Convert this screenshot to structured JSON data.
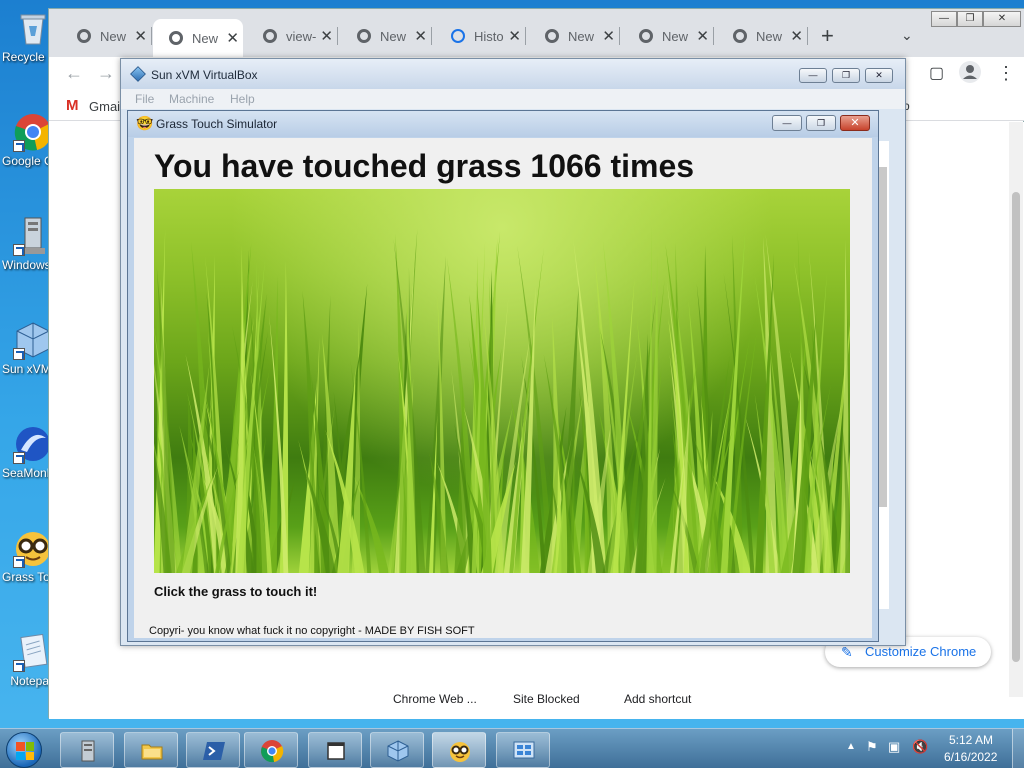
{
  "desktop": {
    "icons": [
      {
        "label": "Recycle Bin",
        "icon": "recycle-bin-icon"
      },
      {
        "label": "Google Chrome",
        "icon": "chrome-icon"
      },
      {
        "label": "Windows Console",
        "icon": "console-icon"
      },
      {
        "label": "Sun xVM VirtualBox",
        "icon": "virtualbox-icon"
      },
      {
        "label": "SeaMonkey",
        "icon": "seamonkey-icon"
      },
      {
        "label": "Grass Touch Simulator",
        "icon": "nerd-face-icon"
      },
      {
        "label": "Notepad",
        "icon": "notepad-icon"
      }
    ]
  },
  "chrome": {
    "tabs": [
      {
        "label": "New",
        "active": false,
        "icon": "chrome-globe-icon"
      },
      {
        "label": "New",
        "active": true,
        "icon": "chrome-globe-icon"
      },
      {
        "label": "view-",
        "active": false,
        "icon": "chrome-globe-icon"
      },
      {
        "label": "New",
        "active": false,
        "icon": "chrome-globe-icon"
      },
      {
        "label": "Histo",
        "active": false,
        "icon": "history-icon"
      },
      {
        "label": "New",
        "active": false,
        "icon": "chrome-globe-icon"
      },
      {
        "label": "New",
        "active": false,
        "icon": "chrome-globe-icon"
      },
      {
        "label": "New",
        "active": false,
        "icon": "chrome-globe-icon"
      }
    ],
    "bookmark": {
      "gmail_label": "Gmail",
      "right_fragment": "b"
    },
    "customize_label": "Customize Chrome",
    "shortcut_tiles": [
      "Chrome Web ...",
      "Site Blocked",
      "Add shortcut"
    ]
  },
  "vbox": {
    "title": "Sun xVM VirtualBox",
    "menu": [
      "File",
      "Machine",
      "Help"
    ]
  },
  "grass_app": {
    "title": "Grass Touch Simulator",
    "headline": "You have touched grass 1066 times",
    "touch_count": 1066,
    "cta": "Click the grass to touch it!",
    "copyright": "Copyri- you know what fuck it no copyright - MADE BY FISH SOFT"
  },
  "taskbar": {
    "items": [
      "server-manager-icon",
      "explorer-folder-icon",
      "powershell-icon",
      "chrome-icon",
      "window-icon",
      "virtualbox-icon",
      "nerd-face-icon",
      "control-panel-icon"
    ],
    "clock": {
      "time": "5:12 AM",
      "date": "6/16/2022"
    }
  },
  "colors": {
    "chrome_link": "#1a73e8",
    "close_red": "#c7432c",
    "desktop_blue": "#2a95dd"
  }
}
